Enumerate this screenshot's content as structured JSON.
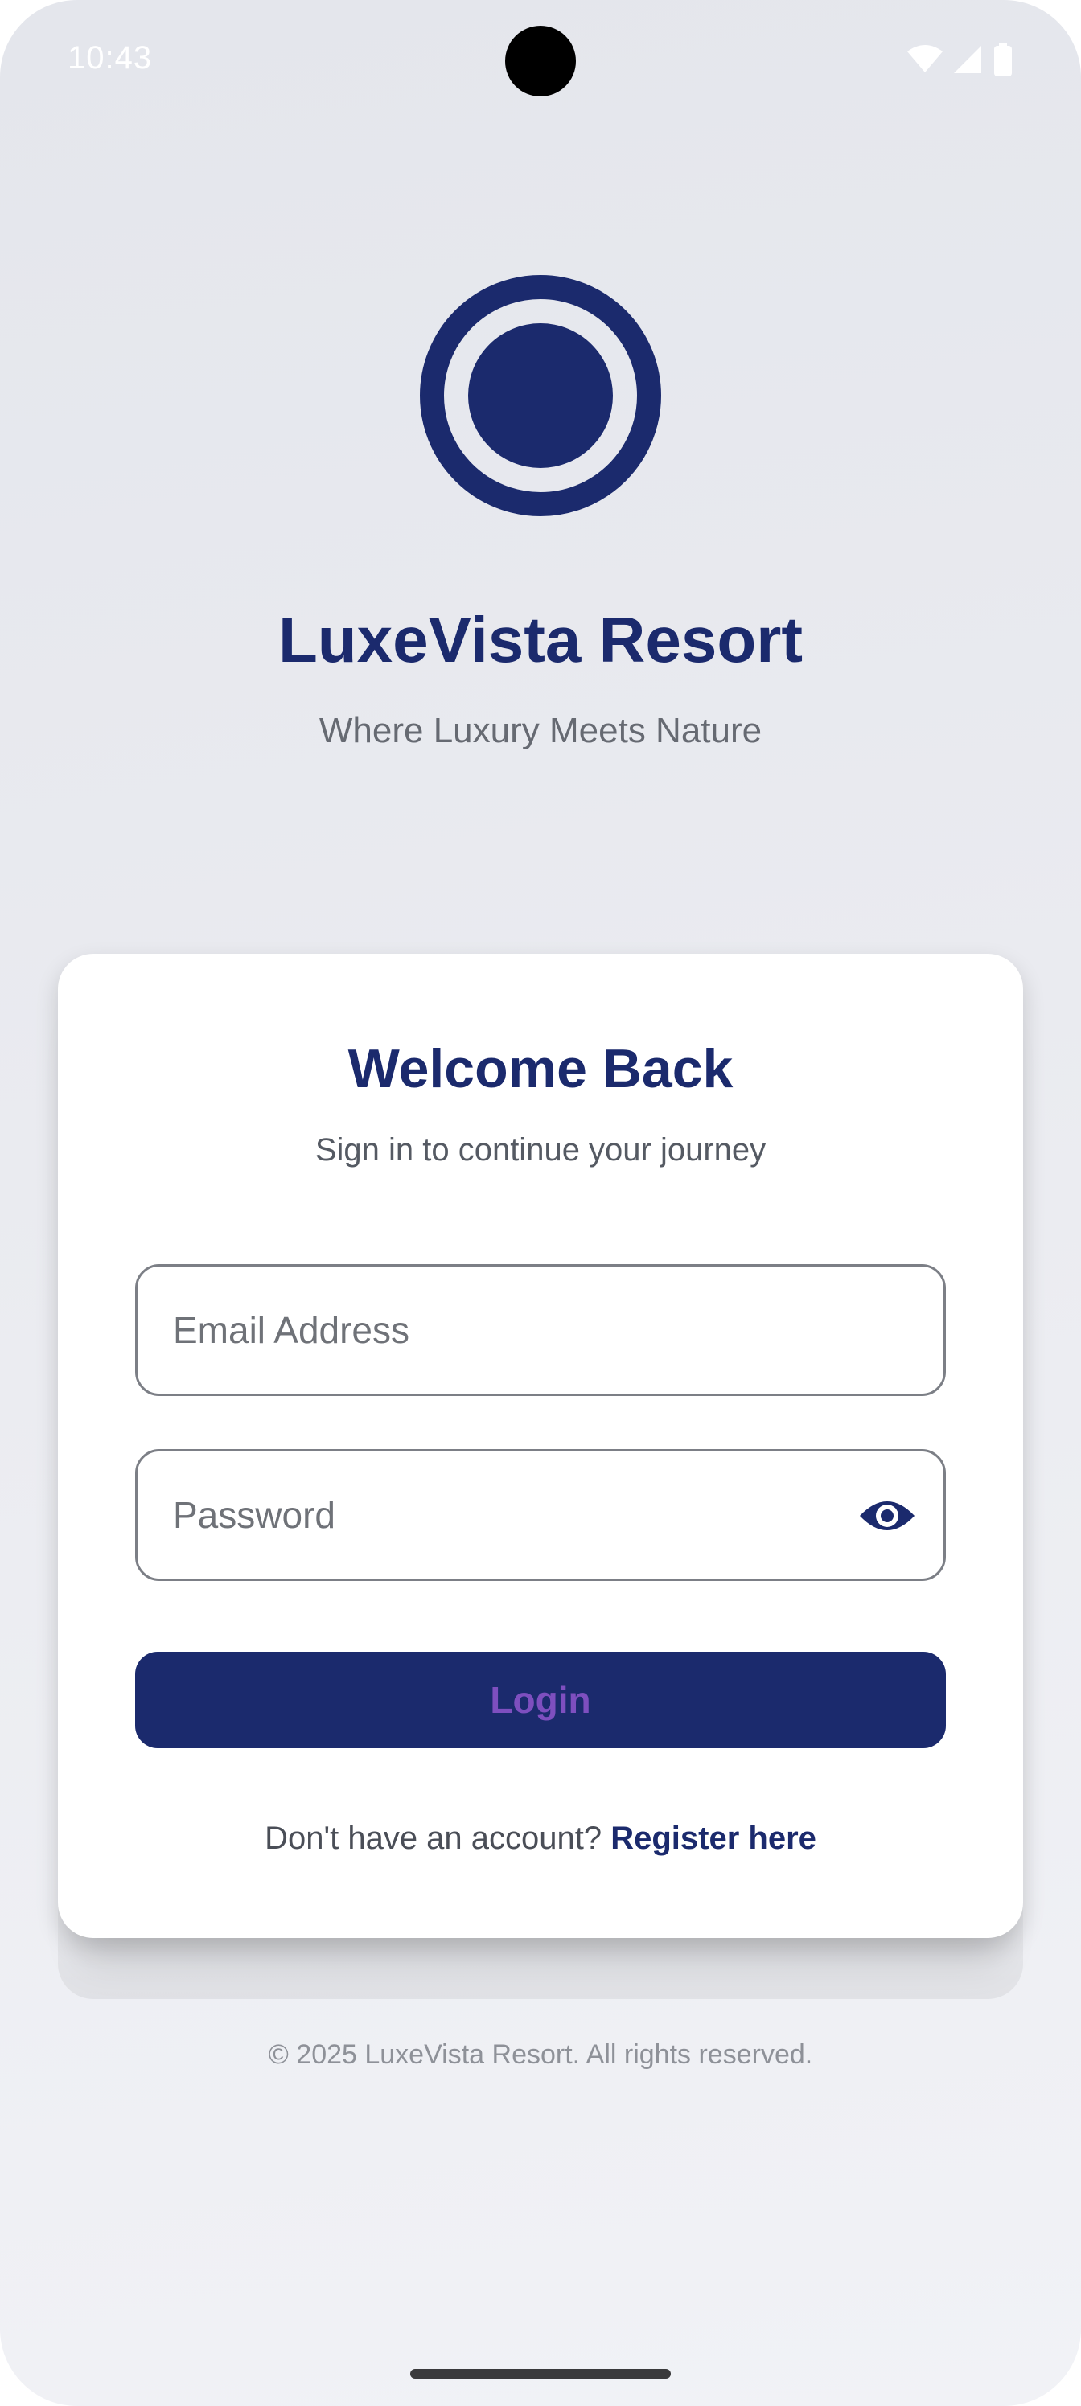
{
  "status_bar": {
    "time": "10:43",
    "icons": [
      "wifi-icon",
      "cellular-signal-icon",
      "battery-icon"
    ]
  },
  "brand": {
    "logo_icon": "circle-logo-icon",
    "title": "LuxeVista Resort",
    "tagline": "Where Luxury Meets Nature"
  },
  "login_card": {
    "title": "Welcome Back",
    "subtitle": "Sign in to continue your journey",
    "email": {
      "placeholder": "Email Address",
      "value": ""
    },
    "password": {
      "placeholder": "Password",
      "value": "",
      "toggle_icon": "eye-icon"
    },
    "login_label": "Login",
    "register_prompt": "Don't have an account?",
    "register_link": "Register here"
  },
  "footer": {
    "copyright": "© 2025 LuxeVista Resort. All rights reserved."
  },
  "colors": {
    "primary": "#1b2a6d",
    "button_text": "#7e4fbf",
    "background": "#e9eaef",
    "card": "#ffffff"
  }
}
